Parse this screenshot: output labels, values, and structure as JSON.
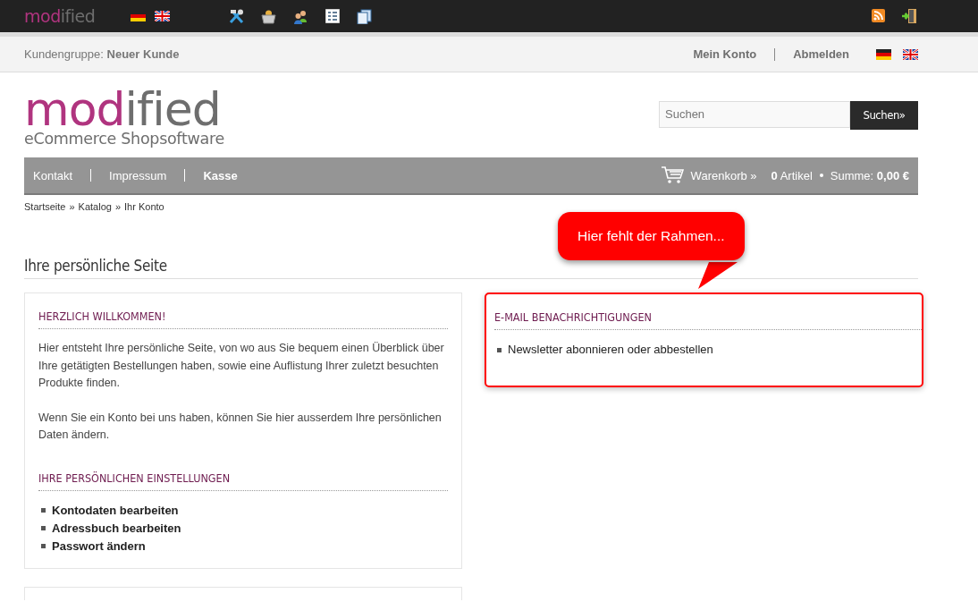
{
  "topbar": {
    "logo": {
      "accent": "mod",
      "rest": "ified"
    }
  },
  "subheader": {
    "group_label": "Kundengruppe:",
    "group_value": "Neuer Kunde",
    "links": [
      "Mein Konto",
      "Abmelden"
    ]
  },
  "header": {
    "logo": {
      "accent": "mod",
      "rest": "ified",
      "tagline": "eCommerce Shopsoftware"
    },
    "search": {
      "placeholder": "Suchen",
      "button": "Suchen»"
    }
  },
  "nav": {
    "items": [
      {
        "label": "Kontakt",
        "bold": false
      },
      {
        "label": "Impressum",
        "bold": false
      },
      {
        "label": "Kasse",
        "bold": true
      }
    ],
    "cart": {
      "label": "Warenkorb »",
      "count": "0",
      "count_label": "Artikel",
      "sum_label": "Summe:",
      "sum": "0,00 €"
    }
  },
  "breadcrumb": {
    "items": [
      "Startseite",
      "Katalog",
      "Ihr Konto"
    ],
    "separator": "»"
  },
  "page_title": "Ihre persönliche Seite",
  "left": [
    {
      "title": "HERZLICH WILLKOMMEN!",
      "paragraphs": [
        "Hier entsteht Ihre persönliche Seite, von wo aus Sie bequem einen Überblick über Ihre getätigten Bestellungen haben, sowie eine Auflistung Ihrer zuletzt besuchten Produkte finden.",
        "Wenn Sie ein Konto bei uns haben, können Sie hier ausserdem Ihre persönlichen Daten ändern."
      ]
    },
    {
      "title": "IHRE PERSÖNLICHEN EINSTELLUNGEN",
      "links": [
        "Kontodaten bearbeiten",
        "Adressbuch bearbeiten",
        "Passwort ändern"
      ]
    }
  ],
  "right": {
    "title": "E-MAIL BENACHRICHTIGUNGEN",
    "links": [
      "Newsletter abonnieren oder abbestellen"
    ],
    "highlighted": true
  },
  "callout": "Hier fehlt der Rahmen..."
}
